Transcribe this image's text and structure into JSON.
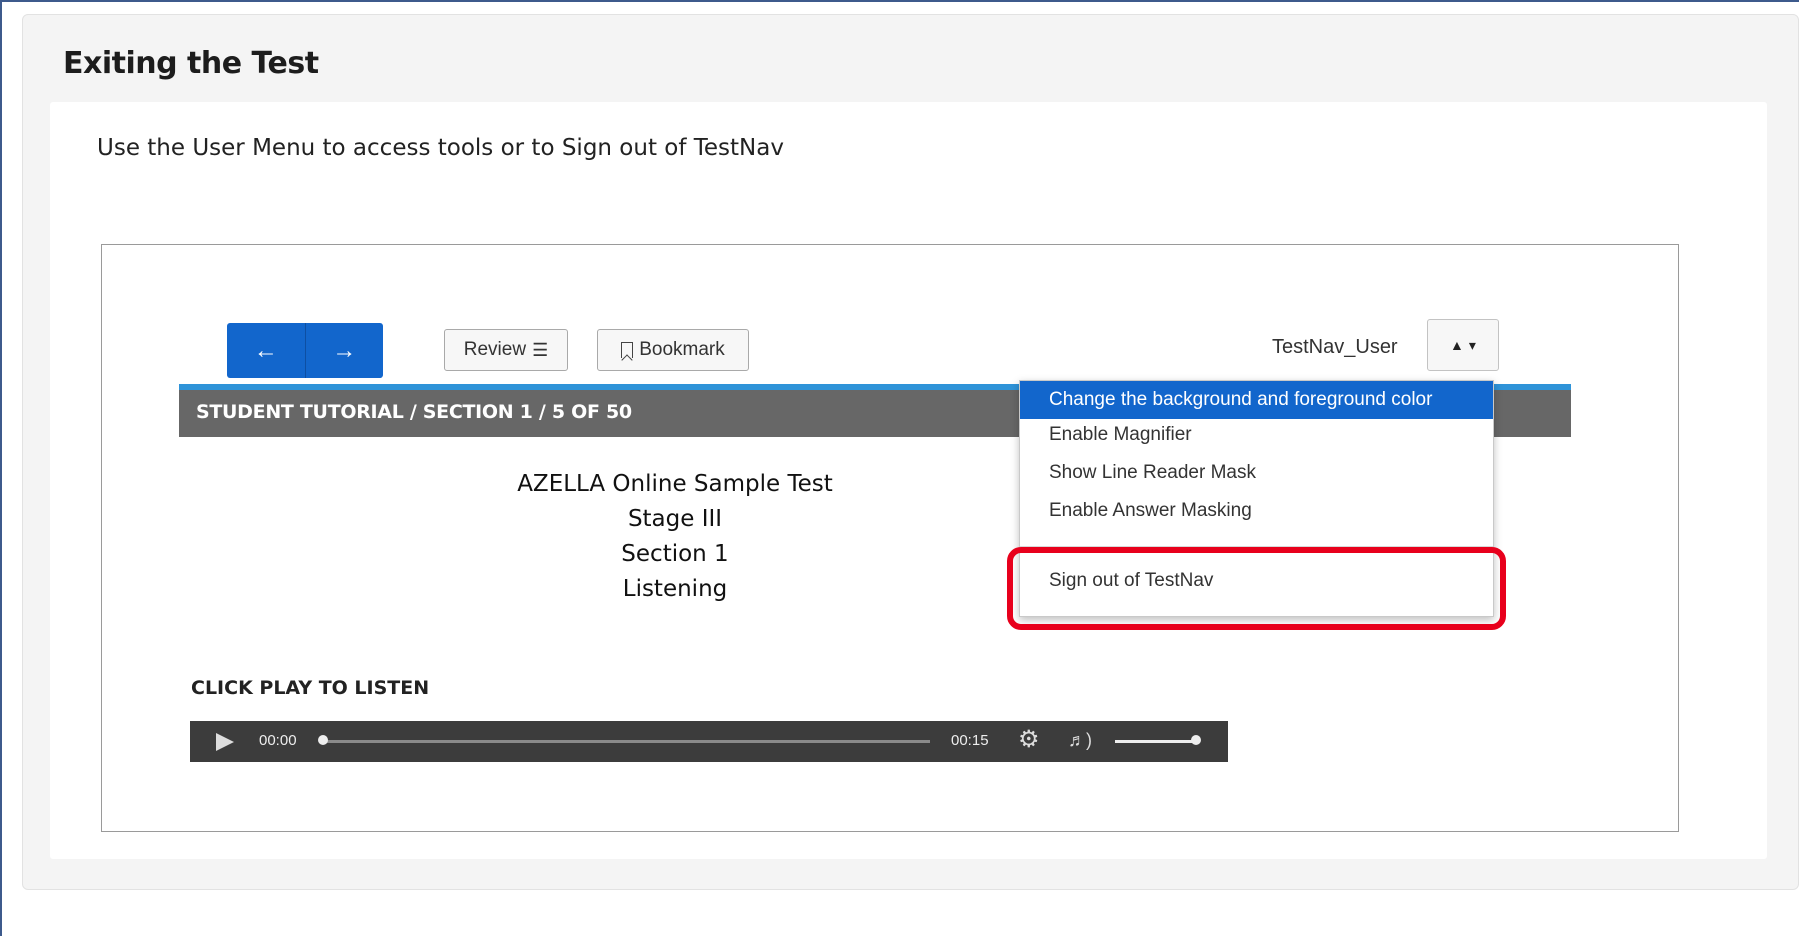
{
  "page": {
    "title": "Exiting the Test",
    "instruction": "Use the User Menu to access tools or to Sign out of TestNav"
  },
  "toolbar": {
    "back_icon": "arrow-left-icon",
    "forward_icon": "arrow-right-icon",
    "review_label": "Review",
    "bookmark_label": "Bookmark",
    "username": "TestNav_User"
  },
  "breadcrumb": "STUDENT TUTORIAL  /  SECTION 1  / 5 OF 50",
  "content": {
    "lines": [
      "AZELLA Online Sample Test",
      "Stage III",
      "Section 1",
      "Listening"
    ]
  },
  "audio": {
    "prompt": "CLICK PLAY TO LISTEN",
    "current_time": "00:00",
    "duration": "00:15",
    "progress": 0,
    "volume": 1
  },
  "user_menu": {
    "items": [
      "Change the background and foreground color",
      "Enable Magnifier",
      "Show Line Reader Mask",
      "Enable Answer Masking",
      "Sign out of TestNav"
    ],
    "active_index": 0,
    "highlighted_item": "Sign out of TestNav"
  },
  "colors": {
    "accent_blue": "#1266cc",
    "highlight_red": "#e8001c",
    "breadcrumb_bg": "#676767"
  }
}
